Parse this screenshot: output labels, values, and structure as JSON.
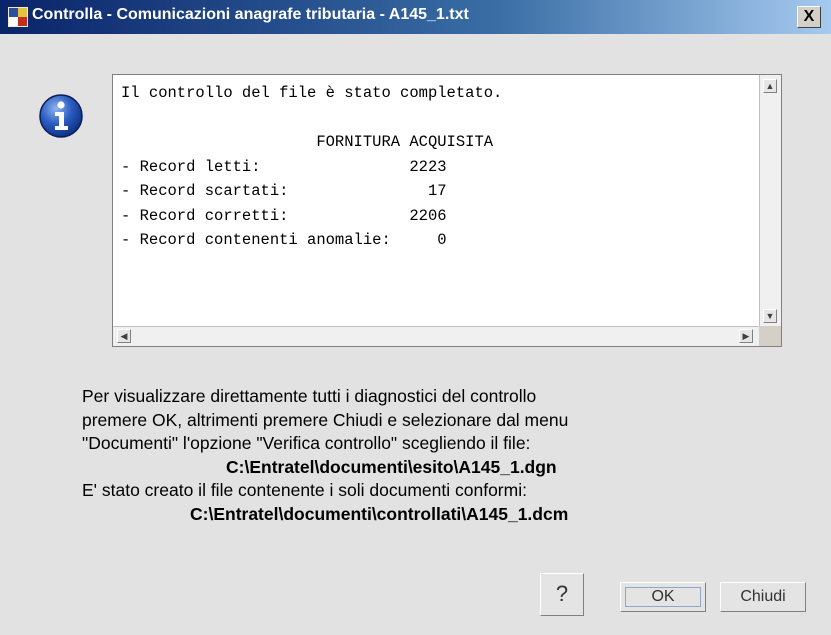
{
  "window": {
    "title": "Controlla - Comunicazioni anagrafe tributaria - A145_1.txt",
    "close_label": "X"
  },
  "report": {
    "text": "Il controllo del file è stato completato.\n\n                     FORNITURA ACQUISITA\n- Record letti:                2223\n- Record scartati:               17\n- Record corretti:             2206\n- Record contenenti anomalie:     0"
  },
  "message": {
    "line1": "Per visualizzare  direttamente  tutti  i diagnostici  del controllo",
    "line2": "premere OK, altrimenti premere Chiudi e selezionare dal menu",
    "line3": "\"Documenti\" l'opzione  \"Verifica controllo\" scegliendo il file:",
    "path1": "C:\\Entratel\\documenti\\esito\\A145_1.dgn",
    "line4": "E' stato creato il file contenente i soli documenti conformi:",
    "path2": "C:\\Entratel\\documenti\\controllati\\A145_1.dcm"
  },
  "buttons": {
    "help": "?",
    "ok": "OK",
    "close": "Chiudi"
  },
  "icons": {
    "title": "app-logo-icon",
    "info": "info-icon"
  },
  "colors": {
    "titlebar_start": "#0a246a",
    "titlebar_end": "#a6caf0",
    "dialog_bg": "#e2e2e2",
    "info_icon": "#1e4fa0"
  }
}
